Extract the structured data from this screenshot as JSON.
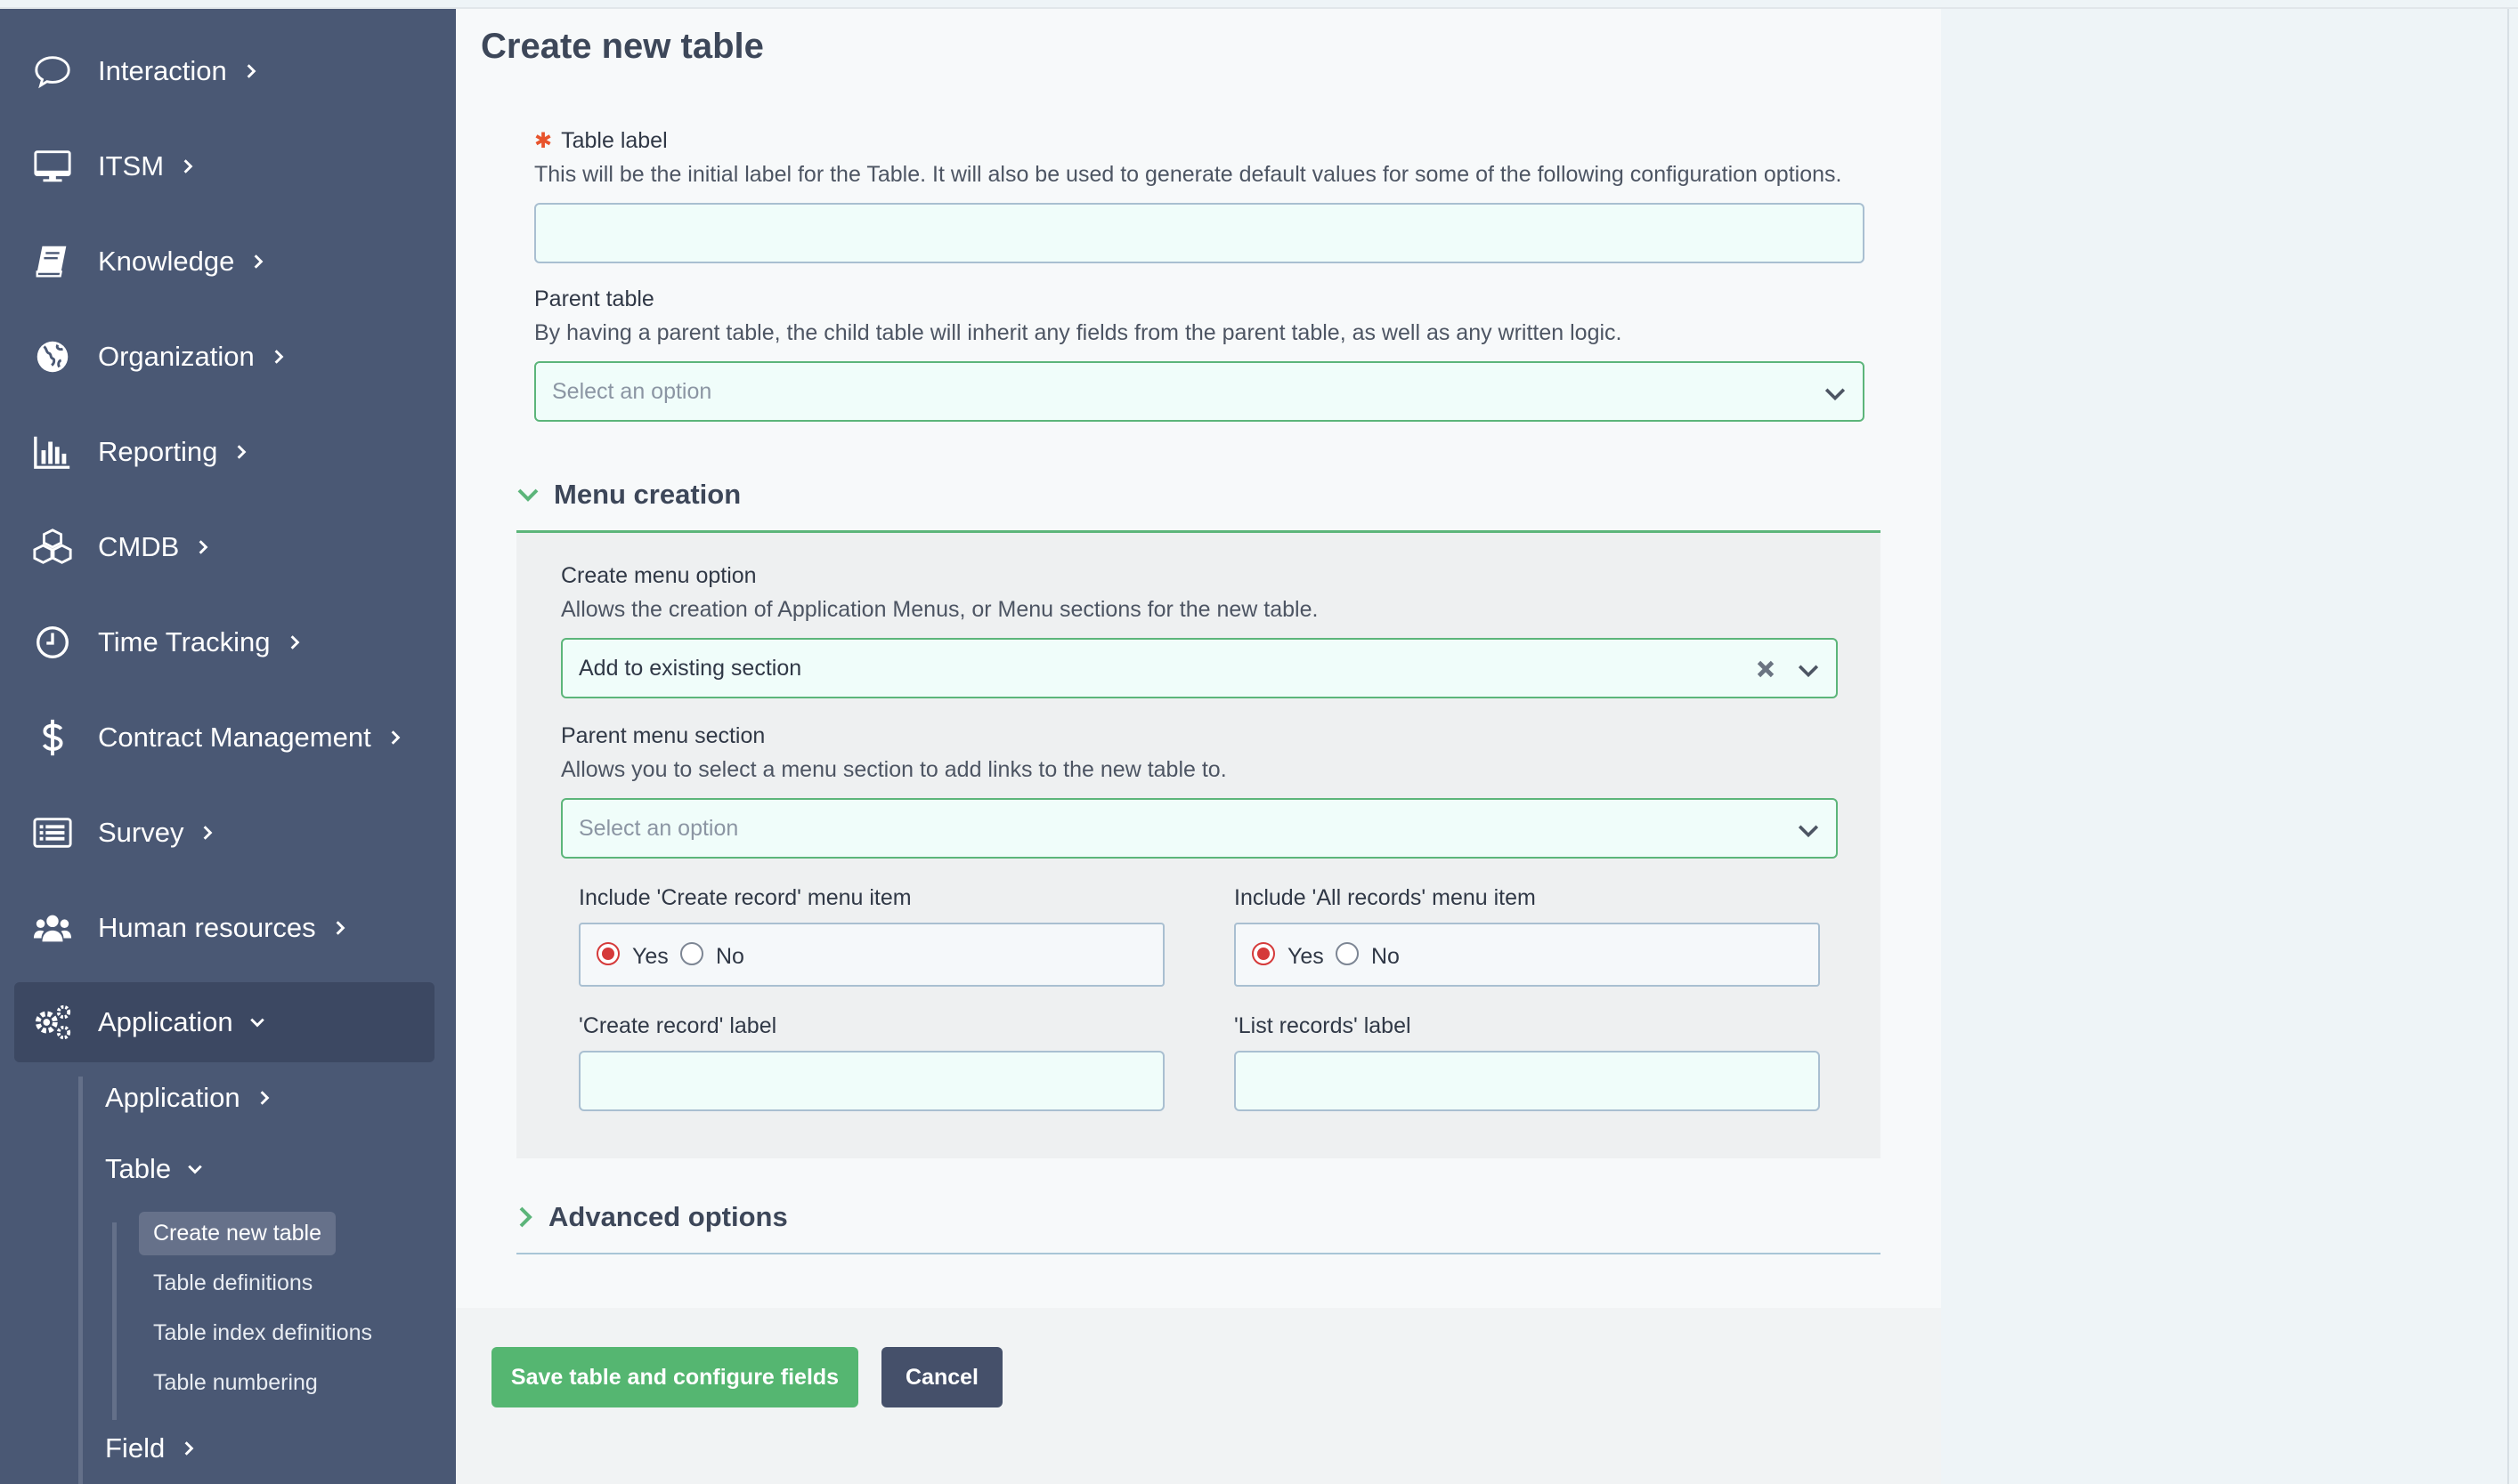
{
  "sidebar": {
    "items": [
      {
        "label": "Interaction",
        "icon": "chat-bubble-icon"
      },
      {
        "label": "ITSM",
        "icon": "monitor-icon"
      },
      {
        "label": "Knowledge",
        "icon": "book-icon"
      },
      {
        "label": "Organization",
        "icon": "globe-icon"
      },
      {
        "label": "Reporting",
        "icon": "bar-chart-icon"
      },
      {
        "label": "CMDB",
        "icon": "cubes-icon"
      },
      {
        "label": "Time Tracking",
        "icon": "clock-icon"
      },
      {
        "label": "Contract Management",
        "icon": "dollar-icon"
      },
      {
        "label": "Survey",
        "icon": "list-icon"
      },
      {
        "label": "Human resources",
        "icon": "users-icon"
      },
      {
        "label": "Application",
        "icon": "gears-icon"
      }
    ],
    "sub_items": [
      {
        "label": "Application"
      },
      {
        "label": "Table"
      },
      {
        "label": "Field"
      }
    ],
    "table_items": [
      {
        "label": "Create new table"
      },
      {
        "label": "Table definitions"
      },
      {
        "label": "Table index definitions"
      },
      {
        "label": "Table numbering"
      }
    ]
  },
  "page": {
    "title": "Create new table"
  },
  "form": {
    "table_label": {
      "label": "Table label",
      "required_mark": "✱",
      "help": "This will be the initial label for the Table. It will also be used to generate default values for some of the following configuration options.",
      "value": ""
    },
    "parent_table": {
      "label": "Parent table",
      "help": "By having a parent table, the child table will inherit any fields from the parent table, as well as any written logic.",
      "placeholder": "Select an option"
    },
    "menu_creation": {
      "heading": "Menu creation",
      "create_menu_option": {
        "label": "Create menu option",
        "help": "Allows the creation of Application Menus, or Menu sections for the new table.",
        "value": "Add to existing section"
      },
      "parent_menu_section": {
        "label": "Parent menu section",
        "help": "Allows you to select a menu section to add links to the new table to.",
        "placeholder": "Select an option"
      },
      "include_create_record": {
        "label": "Include 'Create record' menu item",
        "yes": "Yes",
        "no": "No",
        "selected": "Yes"
      },
      "include_all_records": {
        "label": "Include 'All records' menu item",
        "yes": "Yes",
        "no": "No",
        "selected": "Yes"
      },
      "create_record_label": {
        "label": "'Create record' label",
        "value": ""
      },
      "list_records_label": {
        "label": "'List records' label",
        "value": ""
      }
    },
    "advanced_options": {
      "heading": "Advanced options"
    }
  },
  "buttons": {
    "save": "Save table and configure fields",
    "cancel": "Cancel"
  },
  "colors": {
    "sidebar_bg": "#4a5874",
    "accent_green": "#55b671",
    "radio_red": "#d53a3a",
    "cancel_bg": "#45506a"
  }
}
